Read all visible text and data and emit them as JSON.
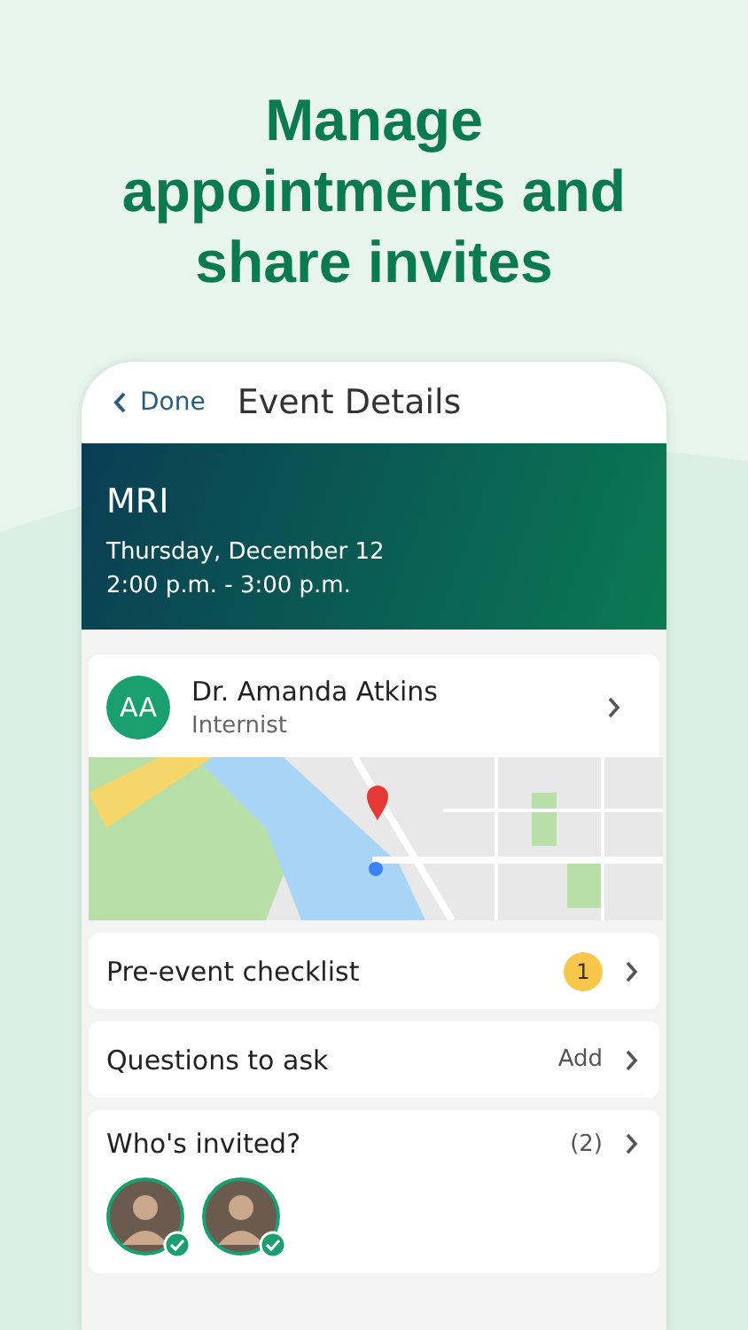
{
  "headline": "Manage appointments and share invites",
  "nav": {
    "back": "Done",
    "title": "Event Details"
  },
  "event": {
    "title": "MRI",
    "date": "Thursday, December 12",
    "time": "2:00 p.m. - 3:00 p.m."
  },
  "provider": {
    "initials": "AA",
    "name": "Dr. Amanda Atkins",
    "specialty": "Internist"
  },
  "rows": [
    {
      "kind": "badge",
      "label": "Pre-event checklist",
      "value": "1"
    },
    {
      "kind": "action",
      "label": "Questions to ask",
      "value": "Add"
    }
  ],
  "invited": {
    "label": "Who's invited?",
    "count": "(2)",
    "people": [
      {
        "accepted": true
      },
      {
        "accepted": true
      }
    ]
  }
}
